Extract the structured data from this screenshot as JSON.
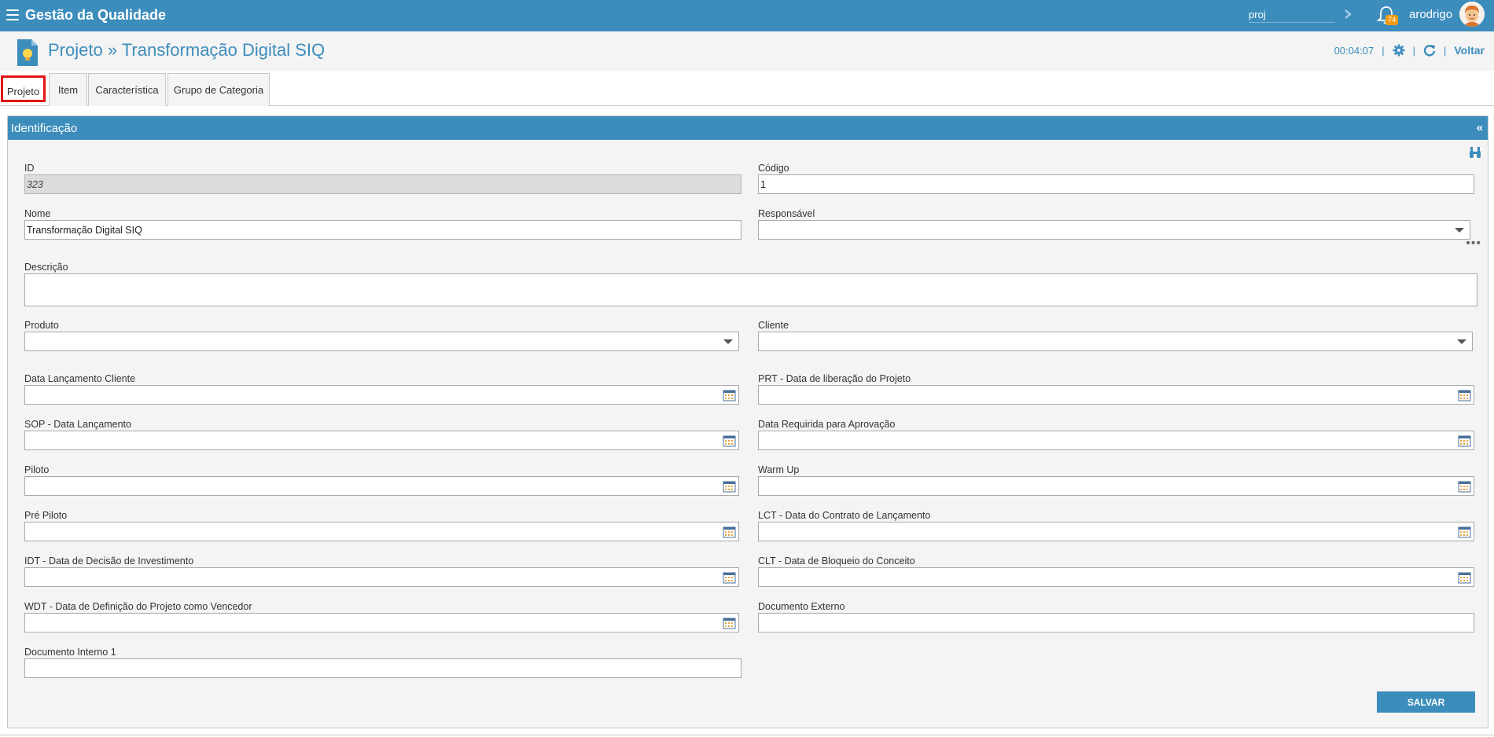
{
  "topbar": {
    "app_title": "Gestão da Qualidade",
    "search_value": "proj",
    "notification_count": "74",
    "username": "arodrigo",
    "icons": [
      "menu-icon",
      "chevron-right-icon",
      "bell-icon",
      "avatar"
    ]
  },
  "header": {
    "title": "Projeto » Transformação Digital SIQ",
    "timer": "00:04:07",
    "separator": "|",
    "back_label": "Voltar",
    "icons": [
      "lightbulb-document-icon",
      "gear-icon",
      "refresh-icon"
    ]
  },
  "tabs": [
    {
      "label": "Projeto",
      "active": true
    },
    {
      "label": "Item",
      "active": false
    },
    {
      "label": "Característica",
      "active": false
    },
    {
      "label": "Grupo de Categoria",
      "active": false
    }
  ],
  "panel": {
    "title": "Identificação",
    "collapse_label": "«",
    "more_label": "•••"
  },
  "fields": {
    "id": {
      "label": "ID",
      "value": "323"
    },
    "codigo": {
      "label": "Código",
      "value": "1"
    },
    "nome": {
      "label": "Nome",
      "value": "Transformação Digital SIQ"
    },
    "responsavel": {
      "label": "Responsável",
      "value": ""
    },
    "descricao": {
      "label": "Descrição",
      "value": ""
    },
    "produto": {
      "label": "Produto",
      "value": ""
    },
    "cliente": {
      "label": "Cliente",
      "value": ""
    },
    "data_lancamento_cliente": {
      "label": "Data Lançamento Cliente",
      "value": ""
    },
    "prt": {
      "label": "PRT - Data de liberação do Projeto",
      "value": ""
    },
    "sop": {
      "label": "SOP - Data Lançamento",
      "value": ""
    },
    "data_requerida": {
      "label": "Data Requirida para Aprovação",
      "value": ""
    },
    "piloto": {
      "label": "Piloto",
      "value": ""
    },
    "warm_up": {
      "label": "Warm Up",
      "value": ""
    },
    "pre_piloto": {
      "label": "Pré Piloto",
      "value": ""
    },
    "lct": {
      "label": "LCT - Data do Contrato de Lançamento",
      "value": ""
    },
    "idt": {
      "label": "IDT - Data de Decisão de Investimento",
      "value": ""
    },
    "clt": {
      "label": "CLT - Data de Bloqueio do Conceito",
      "value": ""
    },
    "wdt": {
      "label": "WDT - Data de Definição do Projeto como Vencedor",
      "value": ""
    },
    "documento_externo": {
      "label": "Documento Externo",
      "value": ""
    },
    "documento_interno_1": {
      "label": "Documento Interno 1",
      "value": ""
    }
  },
  "actions": {
    "save_label": "SALVAR"
  },
  "colors": {
    "primary": "#3c8dbc",
    "badge": "#f39c12",
    "active_tab_border": "#e01414",
    "panel_bg": "#f4f4f4"
  }
}
